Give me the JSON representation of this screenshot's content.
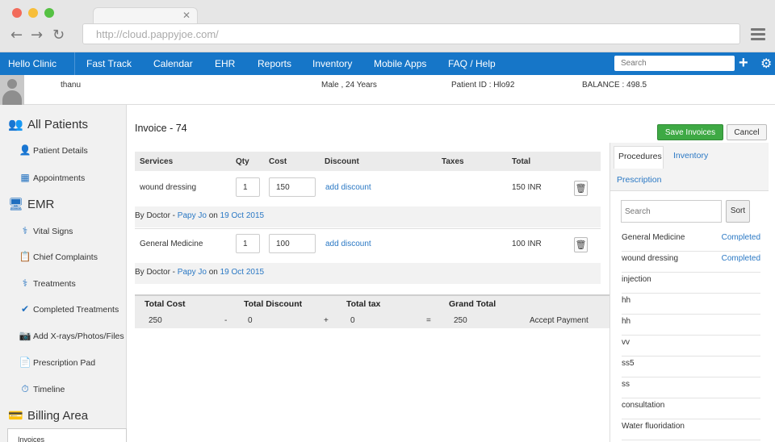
{
  "browser": {
    "url": "http://cloud.pappyjoe.com/"
  },
  "nav": {
    "brand": "Hello Clinic",
    "items": [
      "Fast Track",
      "Calendar",
      "EHR",
      "Reports",
      "Inventory",
      "Mobile Apps",
      "FAQ / Help"
    ],
    "search_placeholder": "Search"
  },
  "patient": {
    "name": "thanu",
    "gender_age": "Male , 24 Years",
    "patient_id": "Patient ID : Hlo92",
    "balance": "BALANCE :  498.5"
  },
  "sidebar": {
    "all_patients": "All Patients",
    "patient_details": "Patient Details",
    "appointments": "Appointments",
    "emr": "EMR",
    "vital_signs": "Vital Signs",
    "chief_complaints": "Chief Complaints",
    "treatments": "Treatments",
    "completed_treatments": "Completed Treatments",
    "add_xrays": "Add X-rays/Photos/Files",
    "prescription_pad": "Prescription Pad",
    "timeline": "Timeline",
    "billing_area": "Billing Area",
    "invoices": "Invoices"
  },
  "invoice": {
    "title": "Invoice - 74",
    "save_label": "Save Invoices",
    "cancel_label": "Cancel",
    "headers": [
      "Services",
      "Qty",
      "Cost",
      "Discount",
      "Taxes",
      "Total"
    ],
    "rows": [
      {
        "service": "wound dressing",
        "qty": "1",
        "cost": "150",
        "discount": "add discount",
        "total": "150 INR",
        "by_prefix": "By Doctor - ",
        "doctor": "Papy Jo",
        "on": " on ",
        "date": "19 Oct 2015"
      },
      {
        "service": "General Medicine",
        "qty": "1",
        "cost": "100",
        "discount": "add discount",
        "total": "100 INR",
        "by_prefix": "By Doctor - ",
        "doctor": "Papy Jo",
        "on": " on ",
        "date": "19 Oct 2015"
      }
    ],
    "totals": {
      "total_cost_label": "Total Cost",
      "total_discount_label": "Total Discount",
      "total_tax_label": "Total tax",
      "grand_total_label": "Grand Total",
      "total_cost": "250",
      "minus": "-",
      "total_discount": "0",
      "plus": "+",
      "total_tax": "0",
      "equals": "=",
      "grand_total": "250",
      "accept_payment": "Accept Payment"
    }
  },
  "right_panel": {
    "tabs": [
      "Procedures",
      "Inventory",
      "Prescription"
    ],
    "search_placeholder": "Search",
    "sort_label": "Sort",
    "procedures": [
      {
        "name": "General Medicine",
        "status": "Completed"
      },
      {
        "name": "wound dressing",
        "status": "Completed"
      },
      {
        "name": "injection",
        "status": ""
      },
      {
        "name": "hh",
        "status": ""
      },
      {
        "name": "hh",
        "status": ""
      },
      {
        "name": "vv",
        "status": ""
      },
      {
        "name": "ss5",
        "status": ""
      },
      {
        "name": "ss",
        "status": ""
      },
      {
        "name": "consultation",
        "status": ""
      },
      {
        "name": "Water fluoridation",
        "status": ""
      }
    ]
  },
  "colors": {
    "nav_blue": "#1676c8",
    "save_green": "#3ea944",
    "link_blue": "#2a78c4"
  }
}
